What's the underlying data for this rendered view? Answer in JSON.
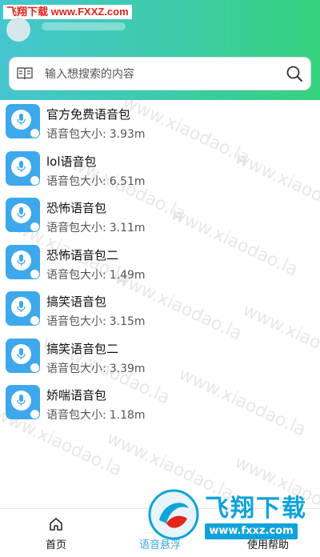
{
  "watermark_top": "飞翔下载 www.FXXZ.com",
  "search": {
    "placeholder": "输入想搜索的内容"
  },
  "list": {
    "size_label": "语音包大小:",
    "items": [
      {
        "name": "官方免费语音包",
        "size": "3.93m"
      },
      {
        "name": "lol语音包",
        "size": "6.51m"
      },
      {
        "name": "恐怖语音包",
        "size": "3.11m"
      },
      {
        "name": "恐怖语音包二",
        "size": "1.49m"
      },
      {
        "name": "搞笑语音包",
        "size": "3.15m"
      },
      {
        "name": "搞笑语音包二",
        "size": "3.39m"
      },
      {
        "name": "娇喘语音包",
        "size": "1.18m"
      }
    ]
  },
  "background_watermark": "www.xiaodao.la",
  "tabs": {
    "home": "首页",
    "voice": "语音悬浮",
    "help": "使用帮助"
  },
  "logo_watermark": {
    "brand": "飞翔下载",
    "url": "www.fxxz.com"
  },
  "colors": {
    "header_start": "#45c6cf",
    "header_end": "#34d27c",
    "thumb": "#3da8ec",
    "active_tab": "#3aa7d8"
  }
}
